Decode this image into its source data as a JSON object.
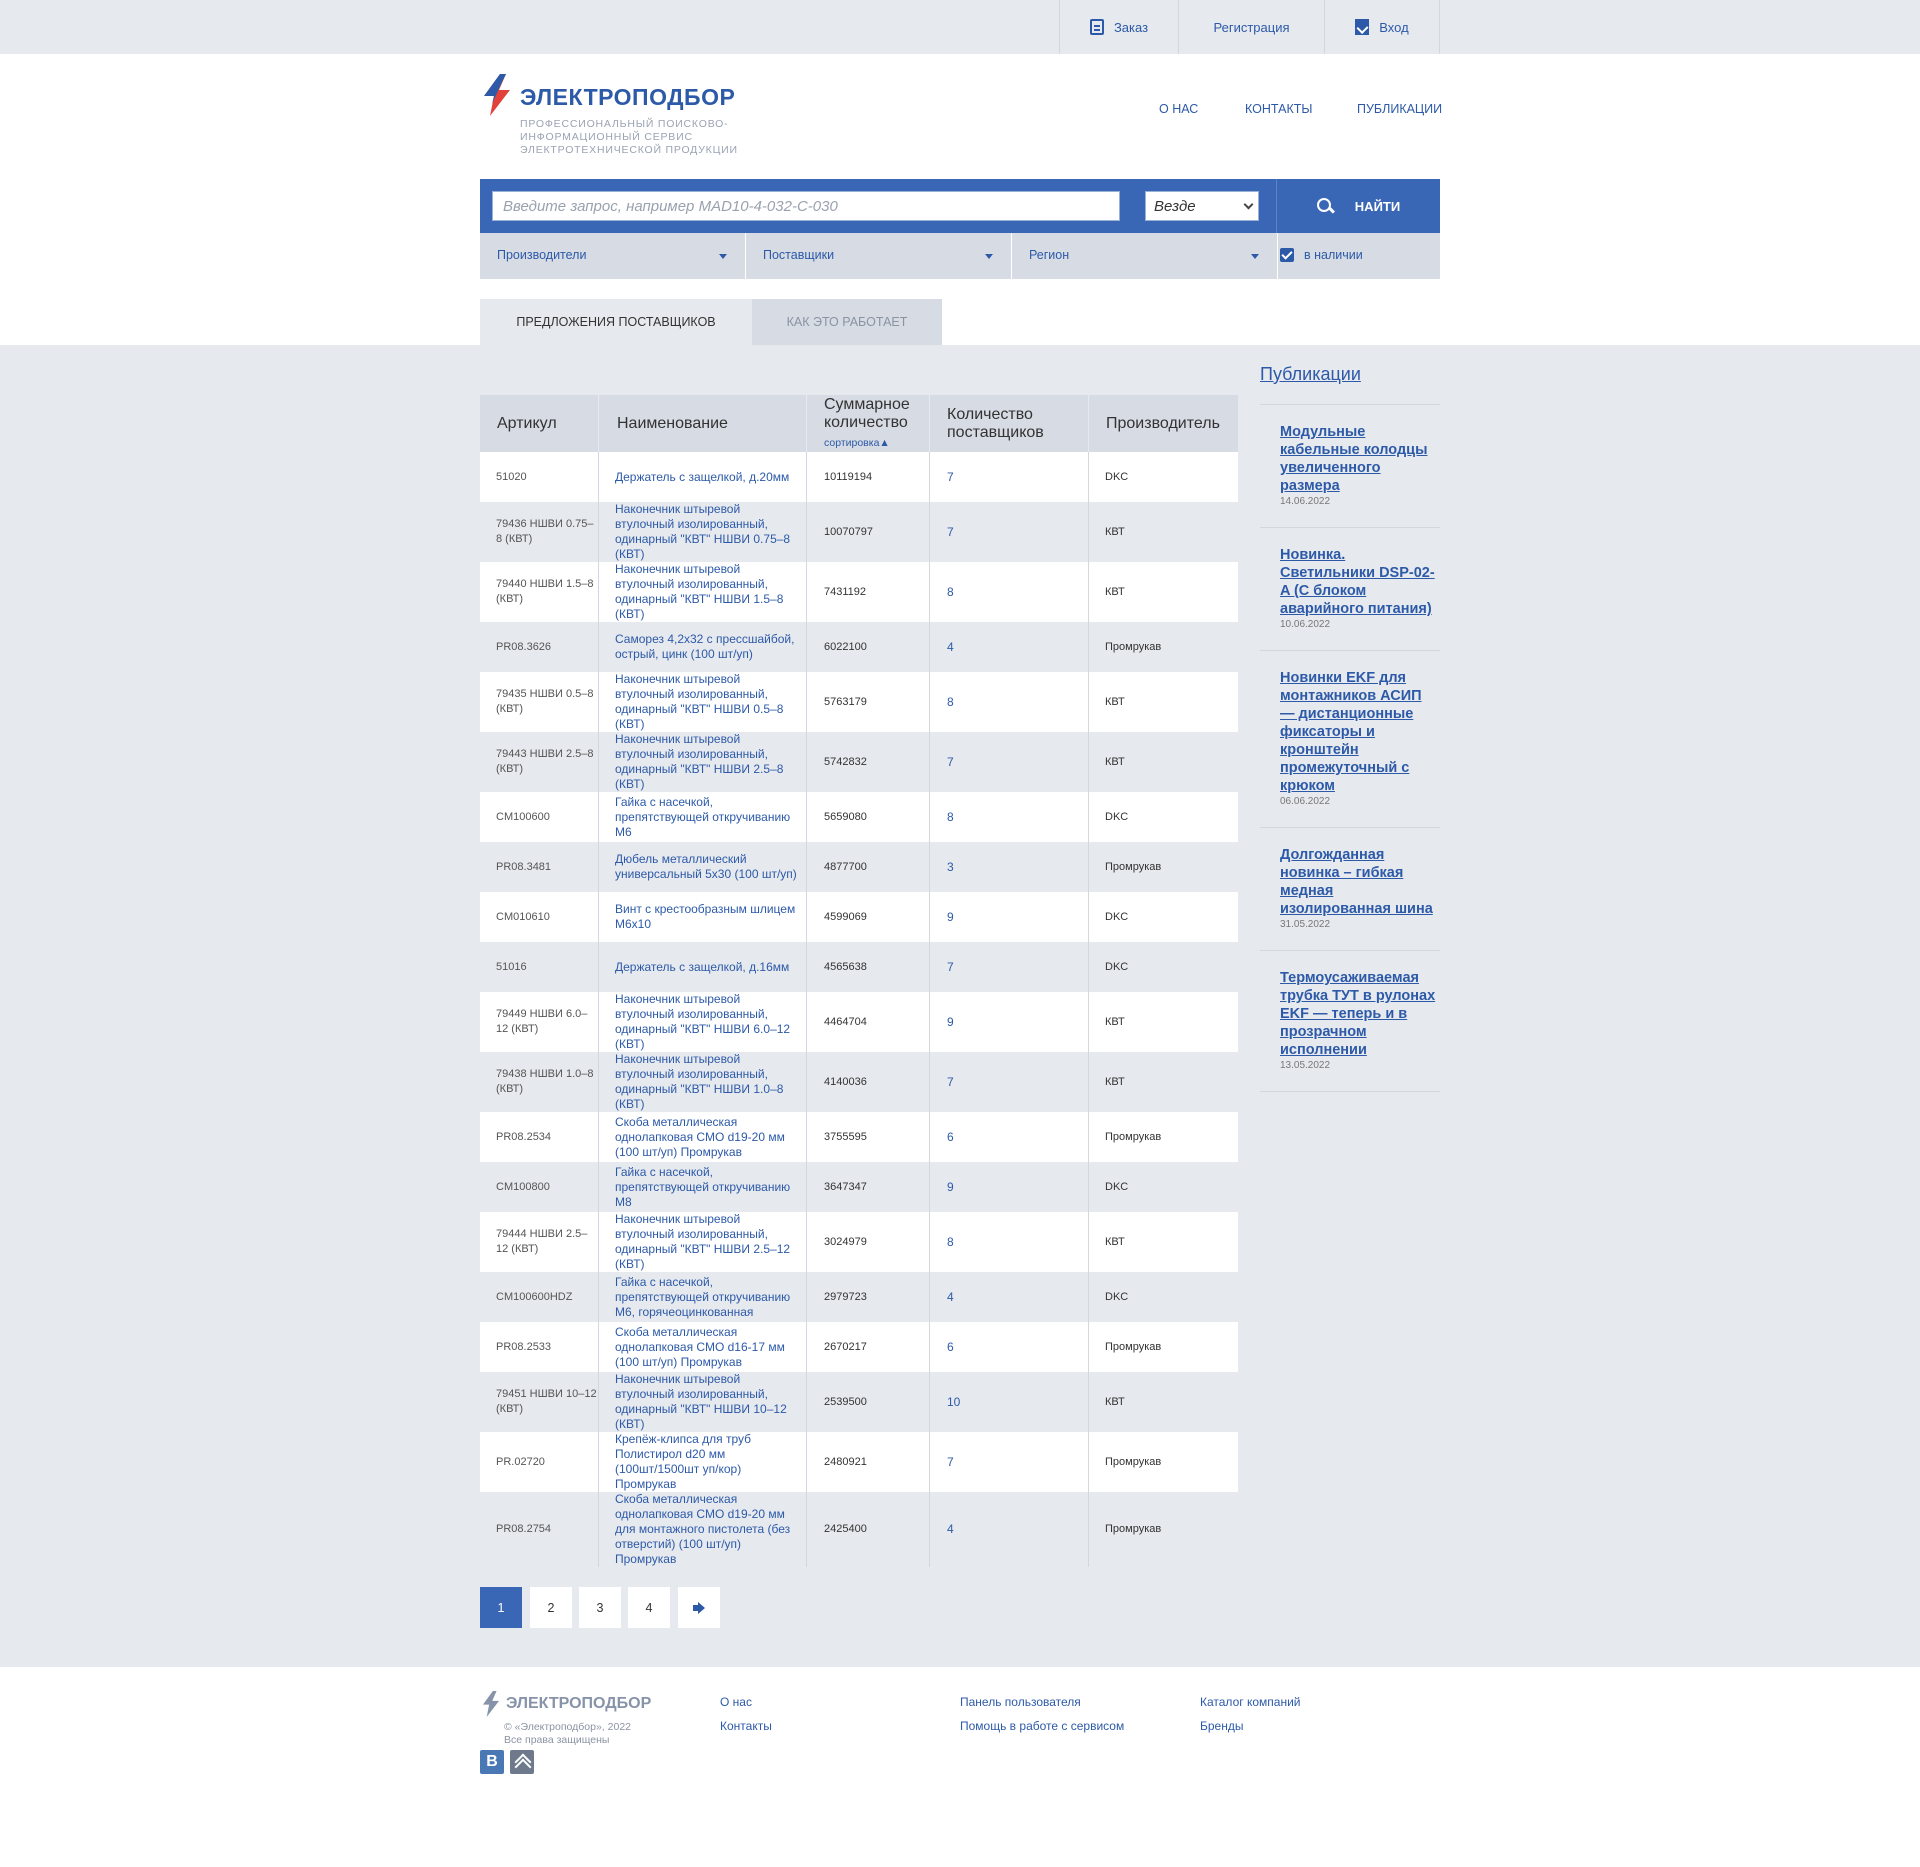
{
  "topbar": {
    "order": "Заказ",
    "register": "Регистрация",
    "login": "Вход"
  },
  "brand": {
    "name": "ЭЛЕКТРОПОДБОР",
    "tagline": "ПРОФЕССИОНАЛЬНЫЙ ПОИСКОВО-ИНФОРМАЦИОННЫЙ СЕРВИС ЭЛЕКТРОТЕХНИЧЕСКОЙ ПРОДУКЦИИ"
  },
  "nav": {
    "about": "О НАС",
    "contacts": "КОНТАКТЫ",
    "publications": "ПУБЛИКАЦИИ"
  },
  "search": {
    "placeholder": "Введите запрос, например MAD10-4-032-C-030",
    "scope": "Везде",
    "button": "НАЙТИ"
  },
  "filters": {
    "manufacturers": "Производители",
    "suppliers": "Поставщики",
    "region": "Регион",
    "in_stock": "в наличии",
    "in_stock_checked": true
  },
  "tabs": {
    "offers": "ПРЕДЛОЖЕНИЯ ПОСТАВЩИКОВ",
    "how": "КАК ЭТО РАБОТАЕТ"
  },
  "table": {
    "headers": {
      "article": "Артикул",
      "name": "Наименование",
      "total_qty": "Суммарное количество",
      "sort": "сортировка▲",
      "suppliers": "Количество поставщиков",
      "manufacturer": "Производитель"
    },
    "rows": [
      {
        "article": "51020",
        "name": "Держатель с защелкой, д.20мм",
        "qty": "10119194",
        "suppliers": "7",
        "manufacturer": "DKC"
      },
      {
        "article": "79436 НШВИ 0.75–8 (КВТ)",
        "name": "Наконечник штыревой втулочный изолированный, одинарный \"КВТ\" НШВИ 0.75–8 (КВТ)",
        "qty": "10070797",
        "suppliers": "7",
        "manufacturer": "КВТ"
      },
      {
        "article": "79440 НШВИ 1.5–8 (КВТ)",
        "name": "Наконечник штыревой втулочный изолированный, одинарный \"КВТ\" НШВИ 1.5–8 (КВТ)",
        "qty": "7431192",
        "suppliers": "8",
        "manufacturer": "КВТ"
      },
      {
        "article": "PR08.3626",
        "name": "Саморез 4,2х32 с прессшайбой, острый, цинк (100 шт/уп)",
        "qty": "6022100",
        "suppliers": "4",
        "manufacturer": "Промрукав"
      },
      {
        "article": "79435 НШВИ 0.5–8 (КВТ)",
        "name": "Наконечник штыревой втулочный изолированный, одинарный \"КВТ\" НШВИ 0.5–8 (КВТ)",
        "qty": "5763179",
        "suppliers": "8",
        "manufacturer": "КВТ"
      },
      {
        "article": "79443 НШВИ 2.5–8 (КВТ)",
        "name": "Наконечник штыревой втулочный изолированный, одинарный \"КВТ\" НШВИ 2.5–8 (КВТ)",
        "qty": "5742832",
        "suppliers": "7",
        "manufacturer": "КВТ"
      },
      {
        "article": "CM100600",
        "name": "Гайка с насечкой, препятствующей откручиванию М6",
        "qty": "5659080",
        "suppliers": "8",
        "manufacturer": "DKC"
      },
      {
        "article": "PR08.3481",
        "name": "Дюбель металлический универсальный 5х30 (100 шт/уп)",
        "qty": "4877700",
        "suppliers": "3",
        "manufacturer": "Промрукав"
      },
      {
        "article": "CM010610",
        "name": "Винт с крестообразным шлицем М6х10",
        "qty": "4599069",
        "suppliers": "9",
        "manufacturer": "DKC"
      },
      {
        "article": "51016",
        "name": "Держатель с защелкой, д.16мм",
        "qty": "4565638",
        "suppliers": "7",
        "manufacturer": "DKC"
      },
      {
        "article": "79449 НШВИ 6.0–12 (КВТ)",
        "name": "Наконечник штыревой втулочный изолированный, одинарный \"КВТ\" НШВИ 6.0–12 (КВТ)",
        "qty": "4464704",
        "suppliers": "9",
        "manufacturer": "КВТ"
      },
      {
        "article": "79438 НШВИ 1.0–8 (КВТ)",
        "name": "Наконечник штыревой втулочный изолированный, одинарный \"КВТ\" НШВИ 1.0–8 (КВТ)",
        "qty": "4140036",
        "suppliers": "7",
        "manufacturer": "КВТ"
      },
      {
        "article": "PR08.2534",
        "name": "Скоба металлическая однолапковая СМО d19-20 мм (100 шт/уп) Промрукав",
        "qty": "3755595",
        "suppliers": "6",
        "manufacturer": "Промрукав"
      },
      {
        "article": "CM100800",
        "name": "Гайка с насечкой, препятствующей откручиванию М8",
        "qty": "3647347",
        "suppliers": "9",
        "manufacturer": "DKC"
      },
      {
        "article": "79444 НШВИ 2.5–12 (КВТ)",
        "name": "Наконечник штыревой втулочный изолированный, одинарный \"КВТ\" НШВИ 2.5–12 (КВТ)",
        "qty": "3024979",
        "suppliers": "8",
        "manufacturer": "КВТ"
      },
      {
        "article": "CM100600HDZ",
        "name": "Гайка с насечкой, препятствующей откручиванию М6, горячеоцинкованная",
        "qty": "2979723",
        "suppliers": "4",
        "manufacturer": "DKC"
      },
      {
        "article": "PR08.2533",
        "name": "Скоба металлическая однолапковая СМО d16-17 мм (100 шт/уп) Промрукав",
        "qty": "2670217",
        "suppliers": "6",
        "manufacturer": "Промрукав"
      },
      {
        "article": "79451 НШВИ 10–12 (КВТ)",
        "name": "Наконечник штыревой втулочный изолированный, одинарный \"КВТ\" НШВИ 10–12 (КВТ)",
        "qty": "2539500",
        "suppliers": "10",
        "manufacturer": "КВТ"
      },
      {
        "article": "PR.02720",
        "name": "Крепёж-клипса для труб Полистирол d20 мм (100шт/1500шт уп/кор) Промрукав",
        "qty": "2480921",
        "suppliers": "7",
        "manufacturer": "Промрукав"
      },
      {
        "article": "PR08.2754",
        "name": "Скоба металлическая однолапковая СМО d19-20 мм для монтажного пистолета (без отверстий) (100 шт/уп) Промрукав",
        "qty": "2425400",
        "suppliers": "4",
        "manufacturer": "Промрукав"
      }
    ]
  },
  "pagination": {
    "pages": [
      "1",
      "2",
      "3",
      "4"
    ],
    "current": "1"
  },
  "sidebar": {
    "title": "Публикации",
    "items": [
      {
        "title": "Модульные кабельные колодцы увеличенного размера",
        "date": "14.06.2022"
      },
      {
        "title": "Новинка. Светильники DSP-02-A (С блоком аварийного питания)",
        "date": "10.06.2022"
      },
      {
        "title": "Новинки EKF для монтажников АСИП — дистанционные фиксаторы и кронштейн промежуточный с крюком",
        "date": "06.06.2022"
      },
      {
        "title": "Долгожданная новинка – гибкая медная изолированная шина",
        "date": "31.05.2022"
      },
      {
        "title": "Термоусаживаемая трубка ТУТ в рулонах EKF — теперь и в прозрачном исполнении",
        "date": "13.05.2022"
      }
    ]
  },
  "footer": {
    "brand": "ЭЛЕКТРОПОДБОР",
    "copyright": "© «Электроподбор», 2022",
    "rights": "Все права защищены",
    "social_vk": "В",
    "links": {
      "about": "О нас",
      "contacts": "Контакты",
      "user_panel": "Панель пользователя",
      "help": "Помощь в работе с сервисом",
      "catalog": "Каталог компаний",
      "brands": "Бренды"
    }
  },
  "colors": {
    "accent": "#3a67b5",
    "link": "#2d5aa8",
    "brand_red": "#e2403a",
    "bg": "#e6e9ee"
  }
}
